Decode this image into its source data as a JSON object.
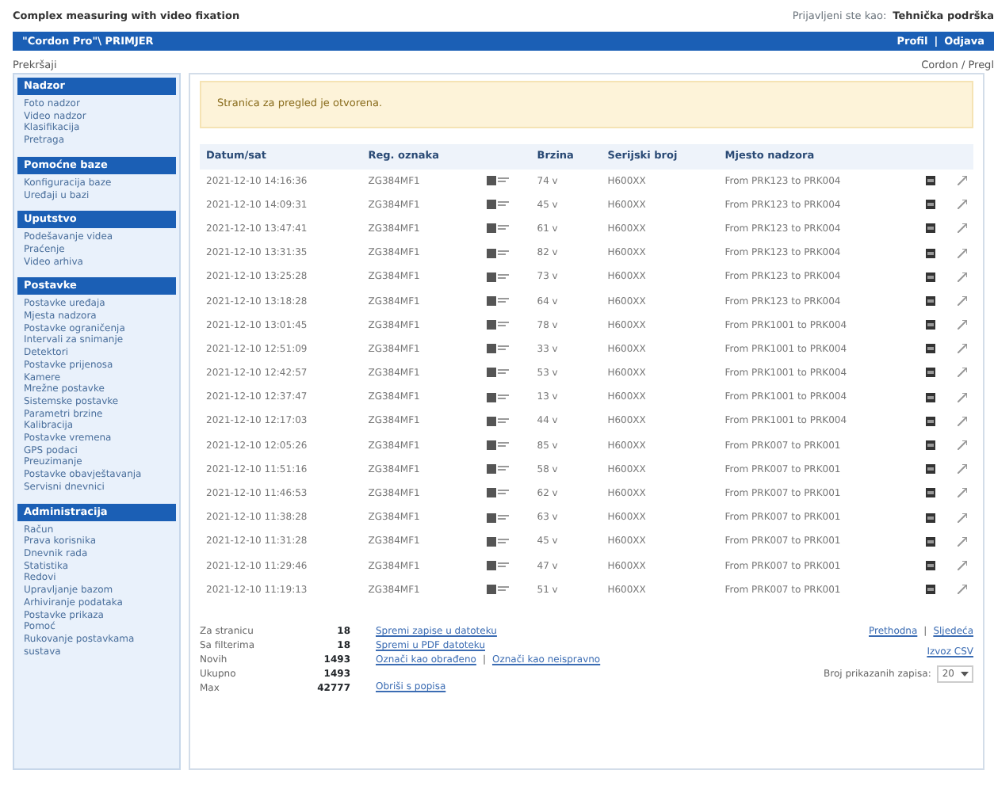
{
  "header": {
    "title": "Complex measuring with video fixation",
    "user_label": "Prijavljeni ste kao:",
    "user_name": "Tehnička podrška"
  },
  "topbar": {
    "title": "\"Cordon Pro\"\\ PRIMJER",
    "links": [
      "Profil",
      "Odjava"
    ]
  },
  "breadcrumb": {
    "page": "Prekršaji",
    "path": "Cordon / Pregl"
  },
  "sidebar": [
    {
      "heading": "Nadzor",
      "items": [
        "Foto nadzor",
        "Video nadzor",
        "Klasifikacija",
        "Pretraga"
      ]
    },
    {
      "heading": "Pomoćne baze",
      "items": [
        "Konfiguracija baze",
        "Uređaji u bazi"
      ]
    },
    {
      "heading": "Uputstvo",
      "items": [
        "Podešavanje videa",
        "Praćenje",
        "Video arhiva"
      ]
    },
    {
      "heading": "Postavke",
      "items": [
        "Postavke uređaja",
        "Mjesta nadzora",
        "Postavke ograničenja",
        "Intervali za snimanje",
        "Detektori",
        "Postavke prijenosa",
        "Kamere",
        "Mrežne postavke",
        "Sistemske postavke",
        "Parametri brzine",
        "Kalibracija",
        "Postavke vremena",
        "GPS podaci",
        "Preuzimanje",
        "Postavke obavještavanja",
        "Servisni dnevnici"
      ]
    },
    {
      "heading": "Administracija",
      "items": [
        "Račun",
        "Prava korisnika",
        "Dnevnik rada",
        "Statistika",
        "Redovi",
        "Upravljanje bazom",
        "Arhiviranje podataka",
        "Postavke prikaza",
        "Pomoć",
        "Rukovanje postavkama",
        "sustava"
      ]
    }
  ],
  "alert": "Stranica za pregled je otvorena.",
  "table": {
    "columns": [
      "Datum/sat",
      "Reg. oznaka",
      "Brzina",
      "Serijski broj",
      "Mjesto nadzora"
    ],
    "rows": [
      {
        "date": "2021-12-10 14:16:36",
        "reg": "ZG384MF1",
        "speed": "74 v",
        "serial": "H600XX",
        "place": "From PRK123 to PRK004"
      },
      {
        "date": "2021-12-10 14:09:31",
        "reg": "ZG384MF1",
        "speed": "45 v",
        "serial": "H600XX",
        "place": "From PRK123 to PRK004"
      },
      {
        "date": "2021-12-10 13:47:41",
        "reg": "ZG384MF1",
        "speed": "61 v",
        "serial": "H600XX",
        "place": "From PRK123 to PRK004"
      },
      {
        "date": "2021-12-10 13:31:35",
        "reg": "ZG384MF1",
        "speed": "82 v",
        "serial": "H600XX",
        "place": "From PRK123 to PRK004"
      },
      {
        "date": "2021-12-10 13:25:28",
        "reg": "ZG384MF1",
        "speed": "73 v",
        "serial": "H600XX",
        "place": "From PRK123 to PRK004"
      },
      {
        "date": "2021-12-10 13:18:28",
        "reg": "ZG384MF1",
        "speed": "64 v",
        "serial": "H600XX",
        "place": "From PRK123 to PRK004"
      },
      {
        "date": "2021-12-10 13:01:45",
        "reg": "ZG384MF1",
        "speed": "78 v",
        "serial": "H600XX",
        "place": "From PRK1001 to PRK004"
      },
      {
        "date": "2021-12-10 12:51:09",
        "reg": "ZG384MF1",
        "speed": "33 v",
        "serial": "H600XX",
        "place": "From PRK1001 to PRK004"
      },
      {
        "date": "2021-12-10 12:42:57",
        "reg": "ZG384MF1",
        "speed": "53 v",
        "serial": "H600XX",
        "place": "From PRK1001 to PRK004"
      },
      {
        "date": "2021-12-10 12:37:47",
        "reg": "ZG384MF1",
        "speed": "13 v",
        "serial": "H600XX",
        "place": "From PRK1001 to PRK004"
      },
      {
        "date": "2021-12-10 12:17:03",
        "reg": "ZG384MF1",
        "speed": "44 v",
        "serial": "H600XX",
        "place": "From PRK1001 to PRK004"
      },
      {
        "date": "2021-12-10 12:05:26",
        "reg": "ZG384MF1",
        "speed": "85 v",
        "serial": "H600XX",
        "place": "From PRK007 to PRK001"
      },
      {
        "date": "2021-12-10 11:51:16",
        "reg": "ZG384MF1",
        "speed": "58 v",
        "serial": "H600XX",
        "place": "From PRK007 to PRK001"
      },
      {
        "date": "2021-12-10 11:46:53",
        "reg": "ZG384MF1",
        "speed": "62 v",
        "serial": "H600XX",
        "place": "From PRK007 to PRK001"
      },
      {
        "date": "2021-12-10 11:38:28",
        "reg": "ZG384MF1",
        "speed": "63 v",
        "serial": "H600XX",
        "place": "From PRK007 to PRK001"
      },
      {
        "date": "2021-12-10 11:31:28",
        "reg": "ZG384MF1",
        "speed": "45 v",
        "serial": "H600XX",
        "place": "From PRK007 to PRK001"
      },
      {
        "date": "2021-12-10 11:29:46",
        "reg": "ZG384MF1",
        "speed": "47 v",
        "serial": "H600XX",
        "place": "From PRK007 to PRK001"
      },
      {
        "date": "2021-12-10 11:19:13",
        "reg": "ZG384MF1",
        "speed": "51 v",
        "serial": "H600XX",
        "place": "From PRK007 to PRK001"
      }
    ]
  },
  "stats": [
    {
      "label": "Za stranicu",
      "value": "18"
    },
    {
      "label": "Sa filterima",
      "value": "18"
    },
    {
      "label": "Novih",
      "value": "1493"
    },
    {
      "label": "Ukupno",
      "value": "1493"
    },
    {
      "label": "Max",
      "value": "42777"
    }
  ],
  "separator": "|",
  "actions": [
    [
      "Spremi zapise u datoteku"
    ],
    [
      "Spremi u PDF datoteku"
    ],
    [
      "Označi kao obrađeno",
      "Označi kao neispravno"
    ],
    [
      "Obriši s popisa"
    ]
  ],
  "pager": {
    "links": [
      "Prethodna",
      "Sljedeća"
    ],
    "export": "Izvoz CSV",
    "per_page_label": "Broj prikazanih zapisa:",
    "per_page": "20"
  }
}
